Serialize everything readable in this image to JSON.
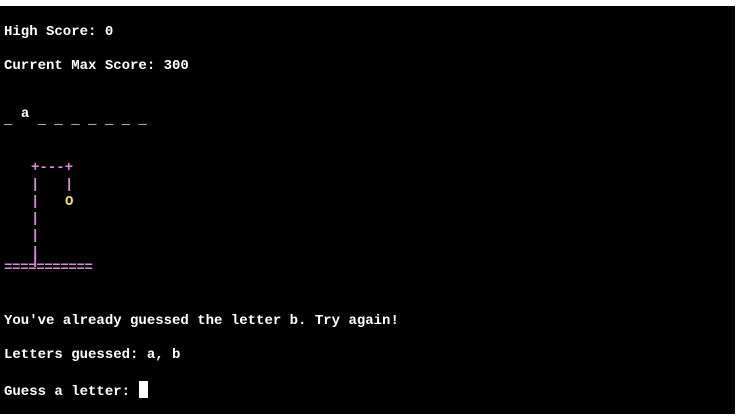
{
  "terminal": {
    "high_score": "High Score: 0",
    "max_score": "Current Max Score: 300",
    "word_prefix": "_ ",
    "revealed_letter": "a",
    "word_suffix": " _ _ _ _ _ _ _",
    "gallows": {
      "top": "+---+",
      "rope_row_left": "|",
      "rope_row_right": "|",
      "head_post": "|",
      "head": "O",
      "posts": [
        "|",
        "|",
        "|",
        "|"
      ],
      "base": "==========="
    },
    "message": "You've already guessed the letter b. Try again!",
    "letters_guessed": "Letters guessed: a, b",
    "prompt": "Guess a letter: "
  },
  "colors": {
    "background": "#000000",
    "text": "#ffffff",
    "gallows": "#d98ad9",
    "head": "#f2e24a"
  }
}
